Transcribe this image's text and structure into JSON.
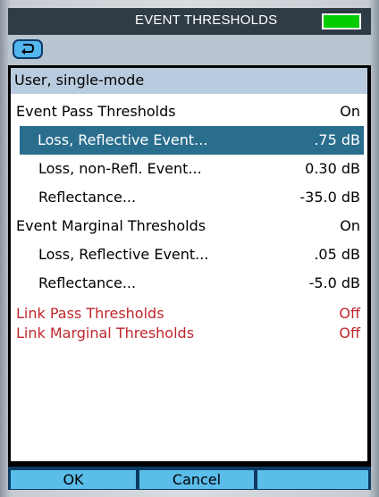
{
  "window": {
    "title": "EVENT THRESHOLDS",
    "battery_color": "#00cc00"
  },
  "toolbar": {
    "back_icon": "back-arrow-icon"
  },
  "list": {
    "header": "User, single-mode",
    "rows": [
      {
        "label": "Event Pass Thresholds",
        "value": "On",
        "level": 0,
        "state": "normal"
      },
      {
        "label": "Loss, Reflective Event...",
        "value": ".75 dB",
        "level": 1,
        "state": "selected"
      },
      {
        "label": "Loss, non-Refl. Event...",
        "value": "0.30 dB",
        "level": 1,
        "state": "normal"
      },
      {
        "label": "Reflectance...",
        "value": "-35.0 dB",
        "level": 1,
        "state": "normal"
      },
      {
        "label": "Event Marginal Thresholds",
        "value": "On",
        "level": 0,
        "state": "normal"
      },
      {
        "label": "Loss, Reflective Event...",
        "value": ".05 dB",
        "level": 1,
        "state": "normal"
      },
      {
        "label": "Reflectance...",
        "value": "-5.0 dB",
        "level": 1,
        "state": "normal"
      },
      {
        "label": "Link Pass Thresholds",
        "value": "Off",
        "level": 0,
        "state": "disabled"
      },
      {
        "label": "Link Marginal Thresholds",
        "value": "Off",
        "level": 0,
        "state": "disabled"
      }
    ]
  },
  "softkeys": {
    "ok": "OK",
    "cancel": "Cancel",
    "third": ""
  },
  "colors": {
    "selected": "#2a6e8e",
    "disabled_text": "#c0262d",
    "header_band": "#b9cbde"
  }
}
